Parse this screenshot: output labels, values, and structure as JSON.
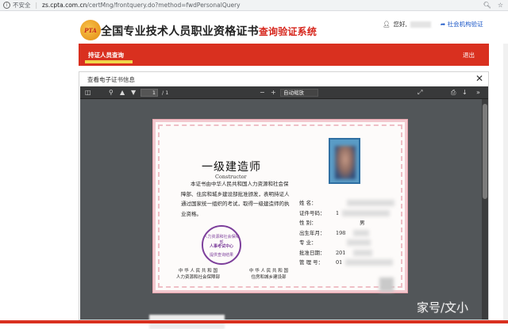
{
  "browser": {
    "security_label": "不安全",
    "url_host": "zs.cpta.com.cn",
    "url_path": "/certMng/frontquery.do?method=fwdPersonalQuery"
  },
  "site": {
    "logo_text": "PTA",
    "title_main": "全国专业技术人员职业资格证书",
    "title_suffix": "查询验证系统",
    "greeting": "您好,",
    "institution_link": "社会机构验证"
  },
  "nav": {
    "tab_label": "持证人员查询",
    "logout_label": "退出"
  },
  "modal": {
    "title": "查看电子证书信息"
  },
  "pdf_toolbar": {
    "page_current": "1",
    "page_total": "/ 1",
    "zoom_label": "自动缩放"
  },
  "certificate": {
    "title": "一级建造师",
    "subtitle": "Constructor",
    "body": "本证书由中华人民共和国人力资源和社会保障部、住房和城乡建设部批准颁发，表明持证人通过国家统一组织的考试，取得一级建造师的执业资格。",
    "seal_top": "人力资源和社会保障部",
    "seal_middle": "人事考试中心",
    "seal_bottom": "提供查询结果",
    "issuer_left_line1": "中 华 人 民 共 和 国",
    "issuer_left_line2": "人力资源和社会保障部",
    "issuer_right_line1": "中 华 人 民 共 和 国",
    "issuer_right_line2": "住房和城乡建设部",
    "fields": [
      {
        "label": "姓    名：",
        "value": ""
      },
      {
        "label": "证件号码：",
        "value": "1"
      },
      {
        "label": "性    别：",
        "value": "男"
      },
      {
        "label": "出生年月：",
        "value": "198"
      },
      {
        "label": "专    业：",
        "value": ""
      },
      {
        "label": "批准日期：",
        "value": "201"
      },
      {
        "label": "管 理 号：",
        "value": "01"
      }
    ]
  },
  "watermark": "家号/文小"
}
